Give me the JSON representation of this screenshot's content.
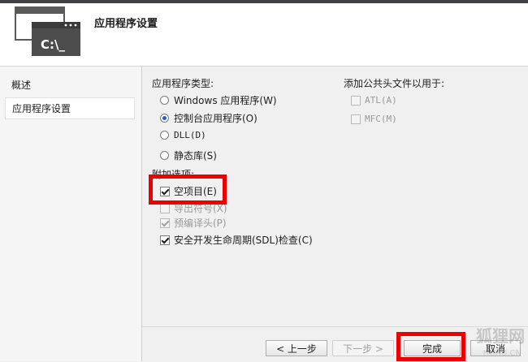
{
  "header": {
    "title": "应用程序设置",
    "icon_text": "C:\\_"
  },
  "sidebar": {
    "items": [
      {
        "label": "概述"
      },
      {
        "label": "应用程序设置"
      }
    ]
  },
  "app_type": {
    "heading": "应用程序类型:",
    "options": [
      {
        "label": "Windows 应用程序(W)",
        "checked": false
      },
      {
        "label": "控制台应用程序(O)",
        "checked": true
      },
      {
        "label": "DLL(D)",
        "checked": false
      },
      {
        "label": "静态库(S)",
        "checked": false
      }
    ]
  },
  "additional": {
    "heading": "附加选项:",
    "options": [
      {
        "label": "空项目(E)",
        "checked": true,
        "enabled": true
      },
      {
        "label": "导出符号(X)",
        "checked": false,
        "enabled": false
      },
      {
        "label": "预编译头(P)",
        "checked": true,
        "enabled": false
      },
      {
        "label": "安全开发生命周期(SDL)检查(C)",
        "checked": true,
        "enabled": true
      }
    ]
  },
  "common_headers": {
    "heading": "添加公共头文件以用于:",
    "options": [
      {
        "label": "ATL(A)",
        "checked": false,
        "enabled": false
      },
      {
        "label": "MFC(M)",
        "checked": false,
        "enabled": false
      }
    ]
  },
  "footer": {
    "prev_label": "< 上一步",
    "next_label": "下一步 >",
    "finish_label": "完成",
    "cancel_label": "取消"
  },
  "watermark": {
    "text": "狐狸网",
    "sub": "HUHU.CN"
  },
  "colors": {
    "highlight": "#ee0000",
    "radio_selected": "#2060c0"
  }
}
